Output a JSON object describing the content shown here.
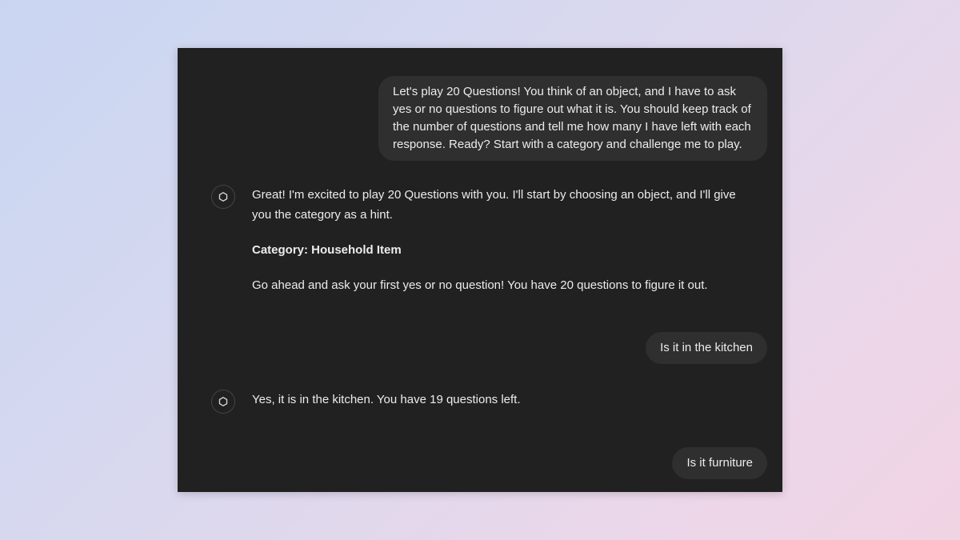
{
  "conversation": {
    "user_message_1": "Let's play 20 Questions! You think of an object, and I have to ask yes or no questions to figure out what it is. You should keep track of the number of questions and tell me how many I have left with each response. Ready? Start with a category and challenge me to play.",
    "assistant_message_1": {
      "intro": "Great! I'm excited to play 20 Questions with you. I'll start by choosing an object, and I'll give you the category as a hint.",
      "category": "Category: Household Item",
      "prompt": "Go ahead and ask your first yes or no question! You have 20 questions to figure it out."
    },
    "user_message_2": "Is it in the kitchen",
    "assistant_message_2": "Yes, it is in the kitchen. You have 19 questions left.",
    "user_message_3": "Is it furniture"
  },
  "icons": {
    "assistant_avatar": "openai-logo-icon"
  },
  "colors": {
    "window_background": "#212121",
    "user_bubble": "#2f2f2f",
    "text": "#ececec"
  }
}
